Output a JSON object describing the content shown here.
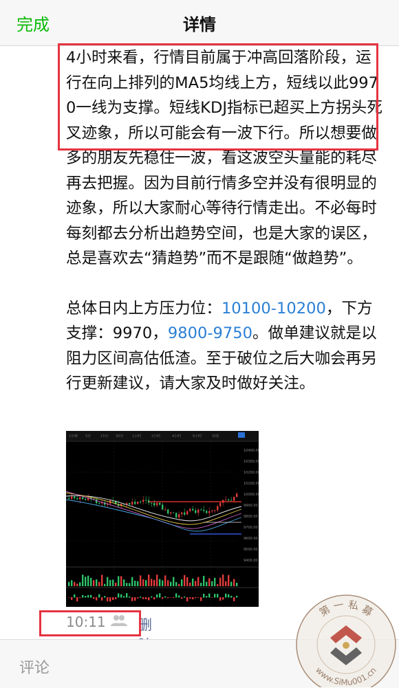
{
  "navbar": {
    "done_label": "完成",
    "title": "详情"
  },
  "post": {
    "paragraph1": "4小时来看，行情目前属于冲高回落阶段，运行在向上排列的MA5均线上方，短线以此9970一线为支撑。短线KDJ指标已超买上方拐头死叉迹象，所以可能会有一波下行。所以想要做多的朋友先稳住一波，看这波空头量能的耗尽再去把握。因为目前行情多空并没有很明显的迹象，所以大家耐心等待行情走出。不必每时每刻都去分析出趋势空间，也是大家的误区，总是喜欢去“猜趋势”而不是跟随“做趋势”。",
    "p2_prefix": "总体日内上方压力位：",
    "p2_link1": "10100-10200",
    "p2_mid": "，下方支撑：9970，",
    "p2_link2": "9800-9750",
    "p2_suffix": "。做单建议就是以阻力区间高估低渣。至于破位之后大咖会再另行更新建议，请大家及时做好关注。",
    "time": "10:11",
    "delete_label": "删除"
  },
  "chart_image": {
    "price_labels": [
      "10400.00",
      "10300.00",
      "10200.00",
      "10100.00",
      "10000.00",
      "9900.00",
      "9800.00",
      "9700.00",
      "9600.00",
      "9500.00",
      "9400.00"
    ]
  },
  "comment": {
    "placeholder": "评论"
  },
  "watermark": {
    "top_text": "第一私募",
    "url_text": "www.SiMu001.cn"
  },
  "colors": {
    "accent_green": "#09bb07",
    "link_blue": "#2a7fd4",
    "highlight_red": "#e53340",
    "meta_blue": "#576b95"
  }
}
